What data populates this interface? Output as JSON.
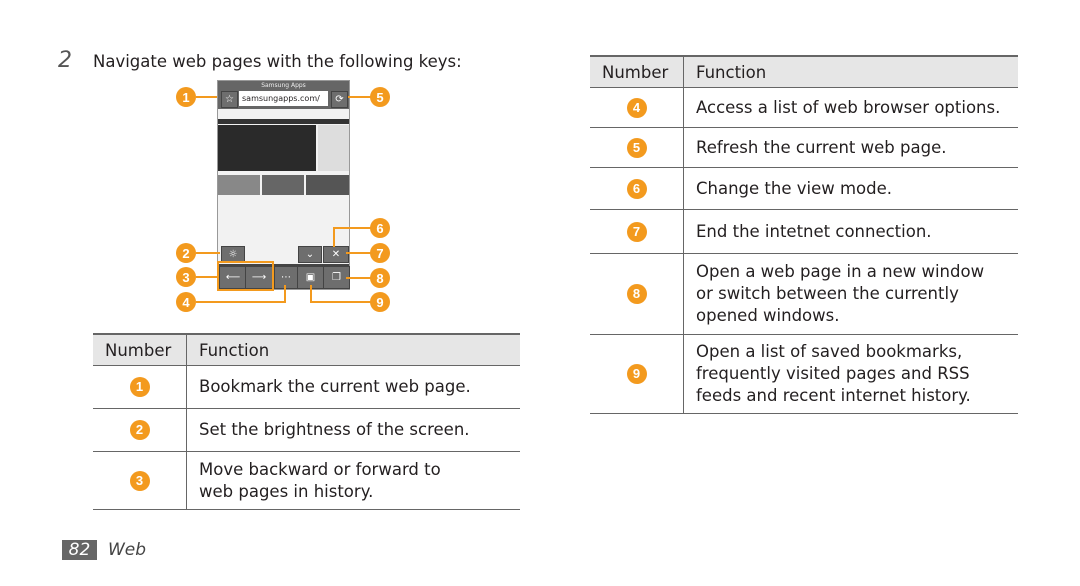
{
  "step": {
    "number": "2",
    "text": "Navigate web pages with the following keys:"
  },
  "phone": {
    "title": "Samsung Apps",
    "url": "samsungapps.com/"
  },
  "colors": {
    "accent": "#f39a1e",
    "header_bg": "#e6e6e6"
  },
  "headers": {
    "number": "Number",
    "function": "Function"
  },
  "left_rows": [
    {
      "n": "1",
      "text": "Bookmark the current web page."
    },
    {
      "n": "2",
      "text": "Set the brightness of the screen."
    },
    {
      "n": "3",
      "text": "Move backward or forward to web pages in history."
    }
  ],
  "right_rows": [
    {
      "n": "4",
      "text": "Access a list of web browser options."
    },
    {
      "n": "5",
      "text": "Refresh the current web page."
    },
    {
      "n": "6",
      "text": "Change the view mode."
    },
    {
      "n": "7",
      "text": "End the intetnet connection."
    },
    {
      "n": "8",
      "text": "Open a web page in a new window or switch between the currently opened windows."
    },
    {
      "n": "9",
      "text": "Open a list of saved bookmarks, frequently visited pages and RSS feeds and recent internet history."
    }
  ],
  "callouts": [
    "1",
    "2",
    "3",
    "4",
    "5",
    "6",
    "7",
    "8",
    "9"
  ],
  "footer": {
    "page": "82",
    "section": "Web"
  }
}
